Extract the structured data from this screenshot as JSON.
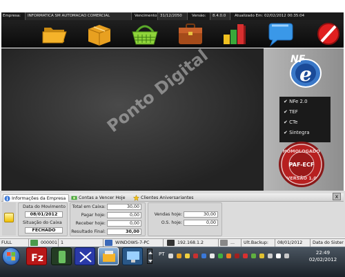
{
  "infobar": {
    "empresa_label": "Empresa:",
    "empresa_value": "INFORMATICA SM AUTOMACAO COMERCIAL",
    "vencimento_label": "Vencimento:",
    "vencimento_value": "31/12/2050",
    "versao_label": "Versão:",
    "versao_value": "8.4.0.0",
    "atualizado_value": "Atualizado Em: 02/02/2012 00:35:04"
  },
  "toolbar": {
    "buttons": [
      {
        "icon": "open-folder-icon"
      },
      {
        "icon": "box-icon"
      },
      {
        "icon": "shopping-basket-icon"
      },
      {
        "icon": "briefcase-icon"
      },
      {
        "icon": "bar-chart-icon"
      },
      {
        "icon": "chat-bubble-icon"
      },
      {
        "icon": "exit-icon"
      }
    ]
  },
  "watermark": "Ponto Digital",
  "nfe": {
    "logo_text": "NFe",
    "menu": [
      "NFe 2.0",
      "TEF",
      "CTe",
      "Sintegra"
    ]
  },
  "seal": {
    "top_text": "HOMOLOGADO",
    "center_text": "PAF-ECF",
    "bottom_text": "VERSÃO 1.0"
  },
  "tabs": [
    {
      "label": "Informações da Empresa",
      "icon": "info-icon"
    },
    {
      "label": "Contas a Vencer Hoje",
      "icon": "money-icon"
    },
    {
      "label": "Clientes Aniversariantes",
      "icon": "star-icon"
    }
  ],
  "close_label": "x",
  "info": {
    "data_movimento_label": "Data do Movimento",
    "data_movimento_value": "08/01/2012",
    "situacao_label": "Situação do Caixa",
    "situacao_value": "FECHADO",
    "total_caixa_label": "Total em Caixa:",
    "total_caixa_value": "30,00",
    "pagar_label": "Pagar hoje:",
    "pagar_value": "0,00",
    "receber_label": "Receber hoje:",
    "receber_value": "0,00",
    "resultado_label": "Resultado Final:",
    "resultado_value": "30,00",
    "vendas_label": "Vendas hoje:",
    "vendas_value": "30,00",
    "os_label": "O.S. hoje:",
    "os_value": "0,00"
  },
  "statusbar": {
    "mode": "FULL",
    "code": "000001",
    "number": "1",
    "computer": "WINDOWS-7-PC",
    "ip": "192.168.1.2",
    "dots": "...",
    "backup_label": "Ult.Backup:",
    "backup_value": "08/01/2012",
    "system_date": "Data do Sister"
  },
  "taskbar": {
    "lang": "PT",
    "time": "22:49",
    "date": "02/02/2012"
  },
  "colors": {
    "toolbar_bg": "#111111",
    "main_bg": "#333333",
    "panel_bg": "#dcdcdc",
    "taskbar_bg": "#2b333c"
  }
}
